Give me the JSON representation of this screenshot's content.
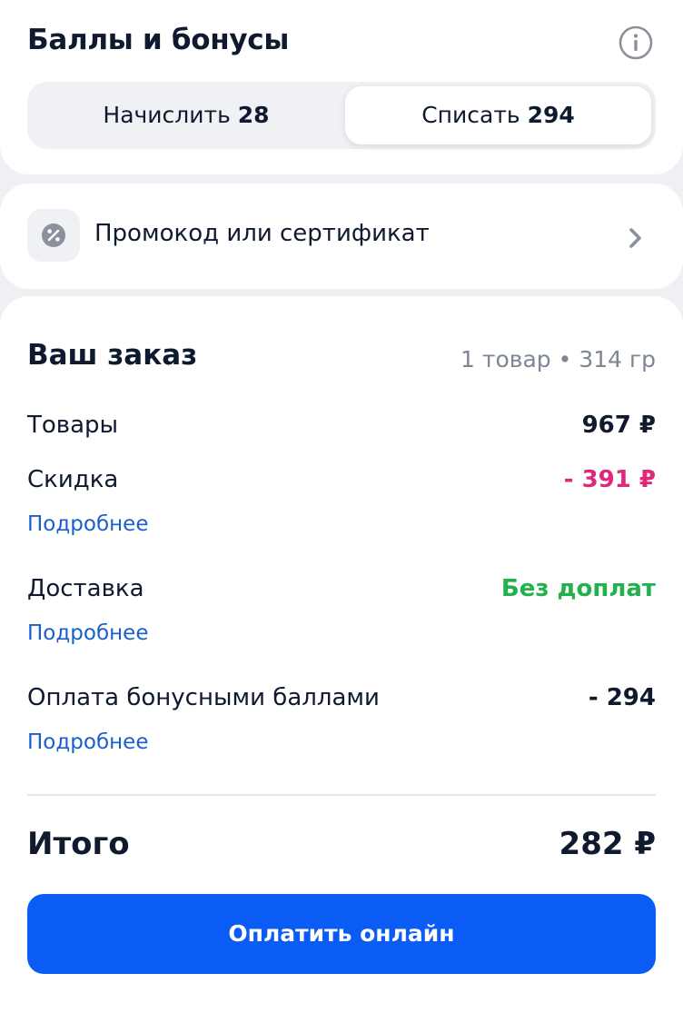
{
  "bonuses": {
    "title": "Баллы и бонусы",
    "info_icon": "info-circle-icon",
    "tabs": [
      {
        "label": "Начислить",
        "value": "28",
        "selected": false
      },
      {
        "label": "Списать",
        "value": "294",
        "selected": true
      }
    ]
  },
  "promo": {
    "icon": "percent-badge-icon",
    "label": "Промокод или сертификат",
    "chevron_icon": "chevron-right-icon"
  },
  "order": {
    "title": "Ваш заказ",
    "meta": "1 товар • 314 гр",
    "rows": [
      {
        "label": "Товары",
        "value": "967 ₽",
        "details": ""
      },
      {
        "label": "Скидка",
        "value": "- 391 ₽",
        "details": "Подробнее"
      },
      {
        "label": "Доставка",
        "value": "Без доплат",
        "details": "Подробнее"
      },
      {
        "label": "Оплата бонусными баллами",
        "value": "- 294",
        "details": "Подробнее"
      }
    ],
    "total_label": "Итого",
    "total_value": "282 ₽",
    "pay_button": "Оплатить онлайн"
  },
  "colors": {
    "background": "#eef0f3",
    "card": "#ffffff",
    "text": "#0f1a2e",
    "muted": "#7d8693",
    "link": "#1b5fcf",
    "discount": "#e0287a",
    "free_delivery": "#22b14c",
    "primary_button": "#0b5cf5"
  }
}
